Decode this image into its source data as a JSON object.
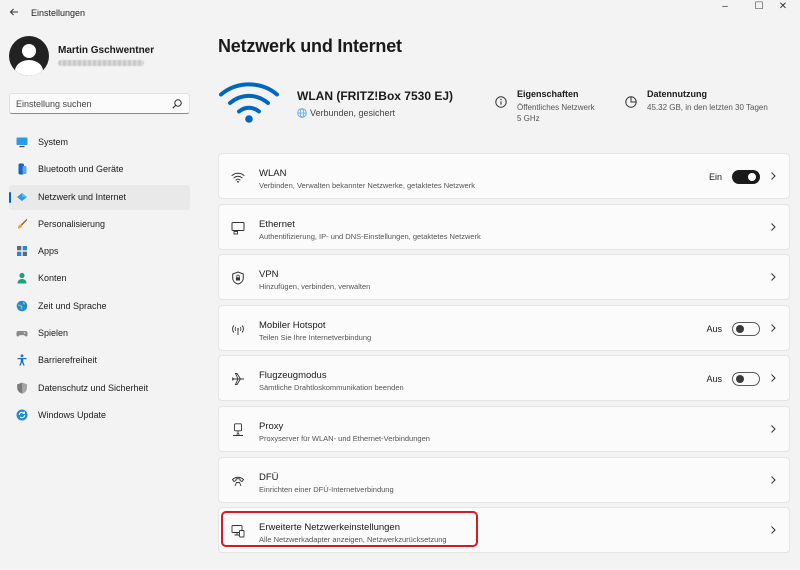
{
  "window": {
    "title": "Einstellungen",
    "back_icon": "back-arrow-icon",
    "controls": [
      "–",
      "☐",
      "✕"
    ]
  },
  "profile": {
    "name": "Martin Gschwentner"
  },
  "search": {
    "placeholder": "Einstellung suchen",
    "icon": "search-icon"
  },
  "sidebar": {
    "items": [
      {
        "label": "System",
        "icon": "system-monitor-icon",
        "color": "#0078d4"
      },
      {
        "label": "Bluetooth und Geräte",
        "icon": "bluetooth-icon",
        "color": "#0067c0"
      },
      {
        "label": "Netzwerk und Internet",
        "icon": "wifi-diamond-icon",
        "color": "#1e88e5",
        "active": true
      },
      {
        "label": "Personalisierung",
        "icon": "brush-icon",
        "color": "#e6a13c"
      },
      {
        "label": "Apps",
        "icon": "apps-icon",
        "color": "#3a6ea5"
      },
      {
        "label": "Konten",
        "icon": "account-icon",
        "color": "#1ba37a"
      },
      {
        "label": "Zeit und Sprache",
        "icon": "globe-clock-icon",
        "color": "#2b87d1"
      },
      {
        "label": "Spielen",
        "icon": "gamepad-icon",
        "color": "#7a7a7a"
      },
      {
        "label": "Barrierefreiheit",
        "icon": "accessibility-icon",
        "color": "#1d6fc9"
      },
      {
        "label": "Datenschutz und Sicherheit",
        "icon": "shield-icon",
        "color": "#6d6d6d"
      },
      {
        "label": "Windows Update",
        "icon": "update-icon",
        "color": "#0078d4"
      }
    ]
  },
  "main": {
    "title": "Netzwerk und Internet",
    "network": {
      "name": "WLAN (FRITZ!Box 7530 EJ)",
      "status": "Verbunden, gesichert",
      "icon": "wifi-large-icon",
      "accent": "#0067c0"
    },
    "properties": {
      "title": "Eigenschaften",
      "line1": "Öffentliches Netzwerk",
      "line2": "5 GHz",
      "icon": "info-icon"
    },
    "data_usage": {
      "title": "Datennutzung",
      "line1": "45.32 GB, in den letzten 30 Tagen",
      "icon": "data-usage-icon"
    },
    "cards": [
      {
        "title": "WLAN",
        "desc": "Verbinden, Verwalten bekannter Netzwerke, getaktetes Netzwerk",
        "icon": "wifi-icon",
        "toggle": "Ein",
        "toggle_on": true
      },
      {
        "title": "Ethernet",
        "desc": "Authentifizierung, IP- und DNS-Einstellungen, getaktetes Netzwerk",
        "icon": "ethernet-icon"
      },
      {
        "title": "VPN",
        "desc": "Hinzufügen, verbinden, verwalten",
        "icon": "vpn-shield-icon"
      },
      {
        "title": "Mobiler Hotspot",
        "desc": "Teilen Sie Ihre Internetverbindung",
        "icon": "hotspot-icon",
        "toggle": "Aus",
        "toggle_on": false
      },
      {
        "title": "Flugzeugmodus",
        "desc": "Sämtliche Drahtloskommunikation beenden",
        "icon": "airplane-icon",
        "toggle": "Aus",
        "toggle_on": false
      },
      {
        "title": "Proxy",
        "desc": "Proxyserver für WLAN- und Ethernet-Verbindungen",
        "icon": "proxy-icon"
      },
      {
        "title": "DFÜ",
        "desc": "Einrichten einer DFÜ-Internetverbindung",
        "icon": "dialup-icon"
      },
      {
        "title": "Erweiterte Netzwerkeinstellungen",
        "desc": "Alle Netzwerkadapter anzeigen, Netzwerkzurücksetzung",
        "icon": "network-adapter-icon",
        "highlighted": true
      }
    ],
    "highlight_color": "#d71a2a"
  }
}
